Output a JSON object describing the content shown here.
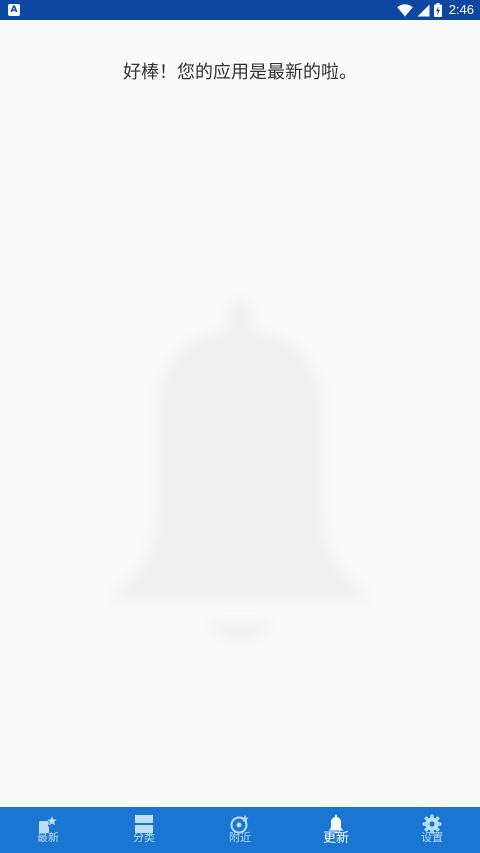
{
  "status_bar": {
    "notification_glyph": "A",
    "time": "2:46",
    "icons": [
      "notification-icon",
      "wifi-icon",
      "signal-icon",
      "battery-charging-icon"
    ],
    "background": "#0d47a1"
  },
  "main": {
    "message": "好棒！您的应用是最新的啦。",
    "illustration": "bell-icon"
  },
  "bottom_nav": {
    "background": "#1976d2",
    "active_color": "#ffffff",
    "inactive_color": "#bbdefb",
    "items": [
      {
        "label": "最新",
        "icon": "star-new-icon",
        "active": false
      },
      {
        "label": "分类",
        "icon": "category-icon",
        "active": false
      },
      {
        "label": "附近",
        "icon": "nearby-icon",
        "active": false
      },
      {
        "label": "更新",
        "icon": "bell-icon",
        "active": true
      },
      {
        "label": "设置",
        "icon": "gear-icon",
        "active": false
      }
    ]
  }
}
